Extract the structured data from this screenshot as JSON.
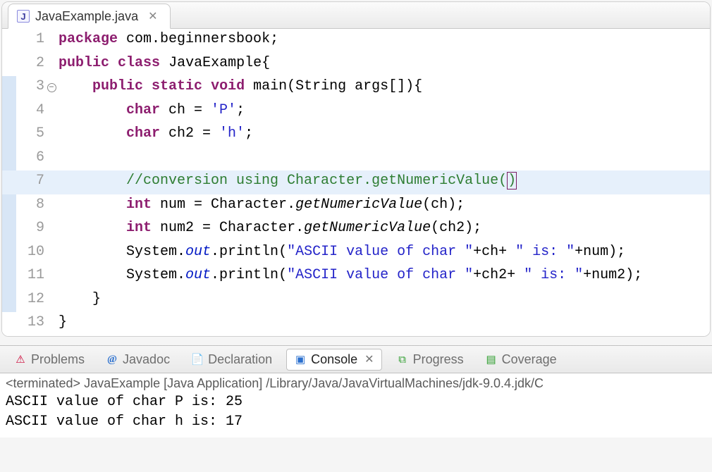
{
  "editor": {
    "tab": {
      "filename": "JavaExample.java",
      "icon_letter": "J"
    },
    "lines": [
      {
        "n": 1,
        "mark": "",
        "fold": "",
        "tokens": [
          [
            "kw",
            "package"
          ],
          [
            "",
            " "
          ],
          [
            "pkg",
            "com.beginnersbook"
          ],
          [
            "",
            ";"
          ]
        ]
      },
      {
        "n": 2,
        "mark": "",
        "fold": "",
        "tokens": [
          [
            "kw",
            "public"
          ],
          [
            "",
            " "
          ],
          [
            "kw",
            "class"
          ],
          [
            "",
            " "
          ],
          [
            "cls",
            "JavaExample"
          ],
          [
            "",
            "{"
          ]
        ]
      },
      {
        "n": 3,
        "mark": "block",
        "fold": "minus",
        "tokens": [
          [
            "",
            "    "
          ],
          [
            "kw",
            "public"
          ],
          [
            "",
            " "
          ],
          [
            "kw",
            "static"
          ],
          [
            "",
            " "
          ],
          [
            "kw",
            "void"
          ],
          [
            "",
            " "
          ],
          [
            "",
            "main(String args[]){"
          ]
        ]
      },
      {
        "n": 4,
        "mark": "block",
        "fold": "",
        "tokens": [
          [
            "",
            "        "
          ],
          [
            "kw",
            "char"
          ],
          [
            "",
            " ch = "
          ],
          [
            "str",
            "'P'"
          ],
          [
            "",
            ";"
          ]
        ]
      },
      {
        "n": 5,
        "mark": "block",
        "fold": "",
        "tokens": [
          [
            "",
            "        "
          ],
          [
            "kw",
            "char"
          ],
          [
            "",
            " ch2 = "
          ],
          [
            "str",
            "'h'"
          ],
          [
            "",
            ";"
          ]
        ]
      },
      {
        "n": 6,
        "mark": "block",
        "fold": "",
        "tokens": [
          [
            "",
            ""
          ]
        ]
      },
      {
        "n": 7,
        "mark": "block",
        "fold": "",
        "cur": true,
        "tokens": [
          [
            "",
            "        "
          ],
          [
            "cmt",
            "//conversion using Character.getNumericValue("
          ],
          [
            "cmt caret-box",
            ")"
          ]
        ]
      },
      {
        "n": 8,
        "mark": "block",
        "fold": "",
        "tokens": [
          [
            "",
            "        "
          ],
          [
            "kw",
            "int"
          ],
          [
            "",
            " num = Character."
          ],
          [
            "meth",
            "getNumericValue"
          ],
          [
            "",
            "(ch);"
          ]
        ]
      },
      {
        "n": 9,
        "mark": "block",
        "fold": "",
        "tokens": [
          [
            "",
            "        "
          ],
          [
            "kw",
            "int"
          ],
          [
            "",
            " num2 = Character."
          ],
          [
            "meth",
            "getNumericValue"
          ],
          [
            "",
            "(ch2);"
          ]
        ]
      },
      {
        "n": 10,
        "mark": "block",
        "fold": "",
        "tokens": [
          [
            "",
            "        System."
          ],
          [
            "fld",
            "out"
          ],
          [
            "",
            ".println("
          ],
          [
            "str",
            "\"ASCII value of char \""
          ],
          [
            "",
            "+ch+ "
          ],
          [
            "str",
            "\" is: \""
          ],
          [
            "",
            "+num);"
          ]
        ]
      },
      {
        "n": 11,
        "mark": "block",
        "fold": "",
        "tokens": [
          [
            "",
            "        System."
          ],
          [
            "fld",
            "out"
          ],
          [
            "",
            ".println("
          ],
          [
            "str",
            "\"ASCII value of char \""
          ],
          [
            "",
            "+ch2+ "
          ],
          [
            "str",
            "\" is: \""
          ],
          [
            "",
            "+num2);"
          ]
        ]
      },
      {
        "n": 12,
        "mark": "block",
        "fold": "",
        "tokens": [
          [
            "",
            "    }"
          ]
        ]
      },
      {
        "n": 13,
        "mark": "",
        "fold": "",
        "tokens": [
          [
            "",
            "}"
          ]
        ]
      }
    ]
  },
  "views": {
    "problems": "Problems",
    "javadoc": "Javadoc",
    "declaration": "Declaration",
    "console": "Console",
    "progress": "Progress",
    "coverage": "Coverage"
  },
  "console": {
    "status": "<terminated> JavaExample [Java Application] /Library/Java/JavaVirtualMachines/jdk-9.0.4.jdk/C",
    "out1": "ASCII value of char P is: 25",
    "out2": "ASCII value of char h is: 17"
  }
}
